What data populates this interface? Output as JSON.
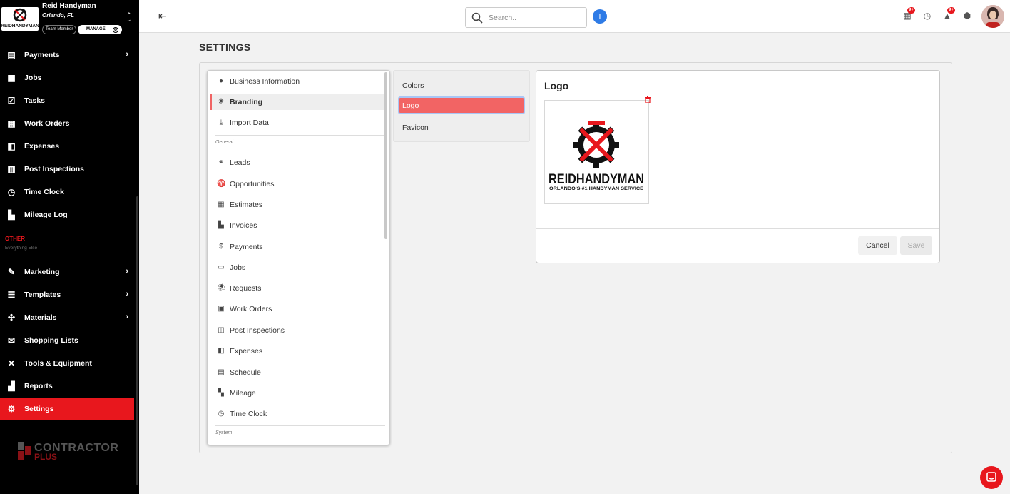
{
  "brand": {
    "name": "Reid Handyman",
    "location": "Orlando, FL",
    "role": "Team Member",
    "manage": "MANAGE",
    "logo_text": "REIDHANDYMAN",
    "logo_tagline": "ORLANDO'S #1 HANDYMAN SERVICE"
  },
  "sidebar": {
    "items": [
      {
        "label": "Payments",
        "icon": "payments-icon",
        "chevron": true
      },
      {
        "label": "Jobs",
        "icon": "briefcase-icon",
        "chevron": false
      },
      {
        "label": "Tasks",
        "icon": "checklist-icon",
        "chevron": false
      },
      {
        "label": "Work Orders",
        "icon": "work-orders-icon",
        "chevron": false
      },
      {
        "label": "Expenses",
        "icon": "wallet-icon",
        "chevron": false
      },
      {
        "label": "Post Inspections",
        "icon": "inspection-icon",
        "chevron": false
      },
      {
        "label": "Time Clock",
        "icon": "clock-icon",
        "chevron": false
      }
    ],
    "mileage": "Mileage Log",
    "other_title": "OTHER",
    "other_sub": "Everything Else",
    "other_items": [
      {
        "label": "Marketing",
        "icon": "marketing-icon",
        "chevron": true
      },
      {
        "label": "Templates",
        "icon": "templates-icon",
        "chevron": true
      },
      {
        "label": "Materials",
        "icon": "materials-icon",
        "chevron": true
      },
      {
        "label": "Shopping Lists",
        "icon": "cart-icon",
        "chevron": false
      },
      {
        "label": "Tools & Equipment",
        "icon": "tools-icon",
        "chevron": false
      },
      {
        "label": "Reports",
        "icon": "reports-icon",
        "chevron": false
      },
      {
        "label": "Settings",
        "icon": "gear-icon",
        "chevron": false,
        "active": true
      }
    ],
    "footer_logo_1": "CONTRACTOR",
    "footer_logo_2": "PLUS"
  },
  "topbar": {
    "search_placeholder": "Search..",
    "add_label": "+",
    "badge_1": "9+",
    "badge_2": "9+"
  },
  "page": {
    "title": "SETTINGS"
  },
  "settings_menu": {
    "top_items": [
      "Business Information",
      "Branding",
      "Import Data"
    ],
    "active": "Branding",
    "section_general": "General",
    "general_items": [
      "Leads",
      "Opportunities",
      "Estimates",
      "Invoices",
      "Payments",
      "Jobs",
      "Requests",
      "Work Orders",
      "Post Inspections",
      "Expenses",
      "Schedule",
      "Mileage",
      "Time Clock"
    ],
    "section_system": "System"
  },
  "branding_menu": {
    "items": [
      "Colors",
      "Logo",
      "Favicon"
    ],
    "active": "Logo"
  },
  "logo_card": {
    "title": "Logo",
    "cancel": "Cancel",
    "save": "Save"
  },
  "colors": {
    "accent": "#e8171d",
    "sidebar_bg": "#000000",
    "primary_blue": "#2e7be6",
    "submenu_active": "#f26464"
  }
}
